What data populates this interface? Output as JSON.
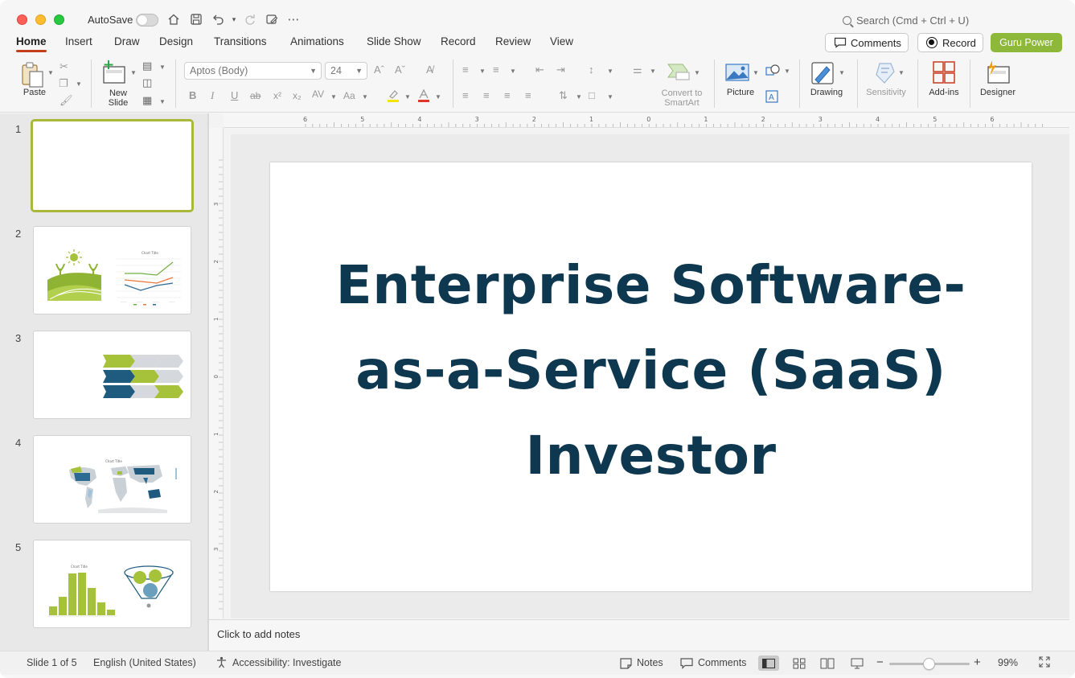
{
  "titlebar": {
    "autosave_label": "AutoSave",
    "search_placeholder": "Search (Cmd + Ctrl + U)"
  },
  "tabs": [
    {
      "label": "Home"
    },
    {
      "label": "Insert"
    },
    {
      "label": "Draw"
    },
    {
      "label": "Design"
    },
    {
      "label": "Transitions"
    },
    {
      "label": "Animations"
    },
    {
      "label": "Slide Show"
    },
    {
      "label": "Record"
    },
    {
      "label": "Review"
    },
    {
      "label": "View"
    }
  ],
  "actions": {
    "comments": "Comments",
    "record": "Record",
    "guru": "Guru Power"
  },
  "ribbon": {
    "paste": "Paste",
    "new_slide": "New\nSlide",
    "font_name": "Aptos (Body)",
    "font_size": "24",
    "convert_smartart": "Convert to\nSmartArt",
    "picture": "Picture",
    "drawing": "Drawing",
    "sensitivity": "Sensitivity",
    "addins": "Add-ins",
    "designer": "Designer"
  },
  "slides": [
    {
      "number": "1"
    },
    {
      "number": "2"
    },
    {
      "number": "3"
    },
    {
      "number": "4"
    },
    {
      "number": "5"
    }
  ],
  "thumb_captions": {
    "chart_title": "Chart Title"
  },
  "ruler": {
    "h_ticks": [
      "6",
      "5",
      "4",
      "3",
      "2",
      "1",
      "0",
      "1",
      "2",
      "3",
      "4",
      "5",
      "6"
    ],
    "v_ticks": [
      "3",
      "2",
      "1",
      "0",
      "1",
      "2",
      "3"
    ]
  },
  "slide": {
    "title": "Enterprise Software-as-a-Service (SaaS) Investor"
  },
  "notes_placeholder": "Click to add notes",
  "status": {
    "slide_of": "Slide 1 of 5",
    "language": "English (United States)",
    "accessibility": "Accessibility: Investigate",
    "notes": "Notes",
    "comments": "Comments",
    "zoom": "99%"
  },
  "colors": {
    "accent_tab": "#c43e1c",
    "guru_button": "#8db83a",
    "title_text": "#0e3750",
    "selected_thumb_border": "#a9b83a"
  }
}
